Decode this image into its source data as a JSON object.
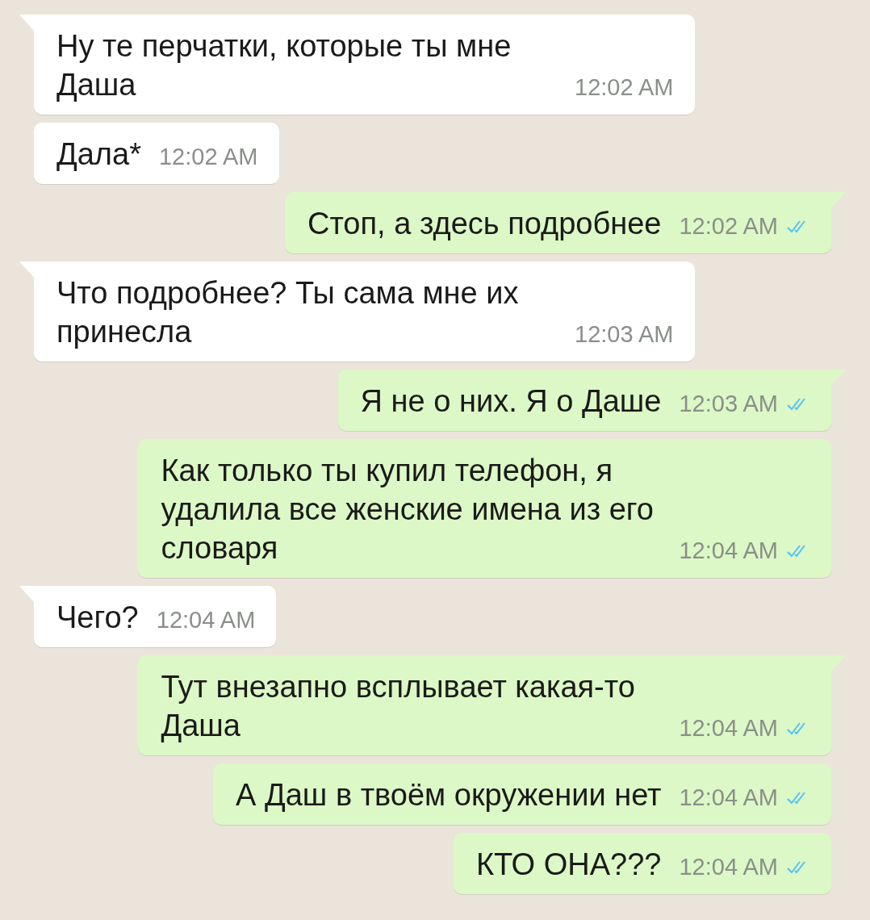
{
  "messages": [
    {
      "kind": "incoming",
      "tail": true,
      "text": "Ну те перчатки, которые ты мне Даша",
      "time": "12:02 AM"
    },
    {
      "kind": "incoming",
      "tail": false,
      "text": "Дала*",
      "time": "12:02 AM"
    },
    {
      "kind": "outgoing",
      "tail": true,
      "text": "Стоп, а здесь подробнее",
      "time": "12:02 AM",
      "read": true
    },
    {
      "kind": "incoming",
      "tail": true,
      "text": "Что подробнее? Ты сама мне их принесла",
      "time": "12:03 AM"
    },
    {
      "kind": "outgoing",
      "tail": true,
      "text": "Я не о них. Я о Даше",
      "time": "12:03 AM",
      "read": true
    },
    {
      "kind": "outgoing",
      "tail": false,
      "text": "Как только ты купил телефон, я удалила все женские имена из его словаря",
      "time": "12:04 AM",
      "read": true
    },
    {
      "kind": "incoming",
      "tail": true,
      "text": "Чего?",
      "time": "12:04 AM"
    },
    {
      "kind": "outgoing",
      "tail": true,
      "text": "Тут внезапно всплывает какая-то Даша",
      "time": "12:04 AM",
      "read": true
    },
    {
      "kind": "outgoing",
      "tail": false,
      "text": "А Даш в твоём окружении нет",
      "time": "12:04 AM",
      "read": true
    },
    {
      "kind": "outgoing",
      "tail": false,
      "text": "КТО ОНА???",
      "time": "12:04 AM",
      "read": true
    }
  ]
}
